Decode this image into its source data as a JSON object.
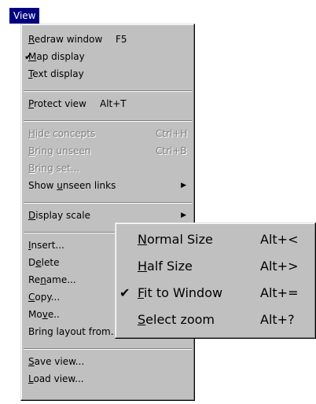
{
  "menubar": {
    "title": "View"
  },
  "menu": {
    "items": [
      {
        "label": "Redraw window",
        "shortcut": "F5",
        "checked": false,
        "disabled": false,
        "underline": 0
      },
      {
        "label": "Map display",
        "shortcut": "",
        "checked": true,
        "disabled": false,
        "underline": 0
      },
      {
        "label": "Text display",
        "shortcut": "",
        "checked": false,
        "disabled": false,
        "underline": 0
      },
      {
        "label": "Protect view",
        "shortcut": "Alt+T",
        "checked": false,
        "disabled": false,
        "underline": 0
      },
      {
        "label": "Hide concepts",
        "shortcut": "Ctrl+H",
        "checked": false,
        "disabled": true,
        "underline": 0
      },
      {
        "label": "Bring unseen",
        "shortcut": "Ctrl+B",
        "checked": false,
        "disabled": true,
        "underline": 0
      },
      {
        "label": "Bring set...",
        "shortcut": "",
        "checked": false,
        "disabled": true,
        "underline": 0
      },
      {
        "label": "Show unseen links",
        "shortcut": "",
        "checked": false,
        "disabled": false,
        "underline": 5,
        "submenu": true
      },
      {
        "label": "Display scale",
        "shortcut": "",
        "checked": false,
        "disabled": false,
        "underline": 0,
        "submenu": true
      },
      {
        "label": "Insert...",
        "shortcut": "",
        "checked": false,
        "disabled": false,
        "underline": 0
      },
      {
        "label": "Delete",
        "shortcut": "",
        "checked": false,
        "disabled": false,
        "underline": 1
      },
      {
        "label": "Rename...",
        "shortcut": "",
        "checked": false,
        "disabled": false,
        "underline": 2
      },
      {
        "label": "Copy...",
        "shortcut": "",
        "checked": false,
        "disabled": false,
        "underline": 0
      },
      {
        "label": "Move..",
        "shortcut": "",
        "checked": false,
        "disabled": false,
        "underline": 2
      },
      {
        "label": "Bring layout from...",
        "shortcut": "",
        "checked": false,
        "disabled": false,
        "underline": -1
      },
      {
        "label": "Save view...",
        "shortcut": "",
        "checked": false,
        "disabled": false,
        "underline": 0
      },
      {
        "label": "Load view...",
        "shortcut": "",
        "checked": false,
        "disabled": false,
        "underline": 0
      }
    ]
  },
  "submenu": {
    "items": [
      {
        "label": "Normal Size",
        "shortcut": "Alt+<",
        "checked": false,
        "underline": 0
      },
      {
        "label": "Half Size",
        "shortcut": "Alt+>",
        "checked": false,
        "underline": 0
      },
      {
        "label": "Fit to Window",
        "shortcut": "Alt+=",
        "checked": true,
        "underline": 0
      },
      {
        "label": "Select zoom",
        "shortcut": "Alt+?",
        "checked": false,
        "underline": 0
      }
    ]
  },
  "icons": {
    "check": "checkmark-icon",
    "submenu_arrow": "triangle-right-icon"
  },
  "colors": {
    "menu_bg": "#c0c0c0",
    "highlight": "#000080",
    "disabled_text": "#808080"
  }
}
